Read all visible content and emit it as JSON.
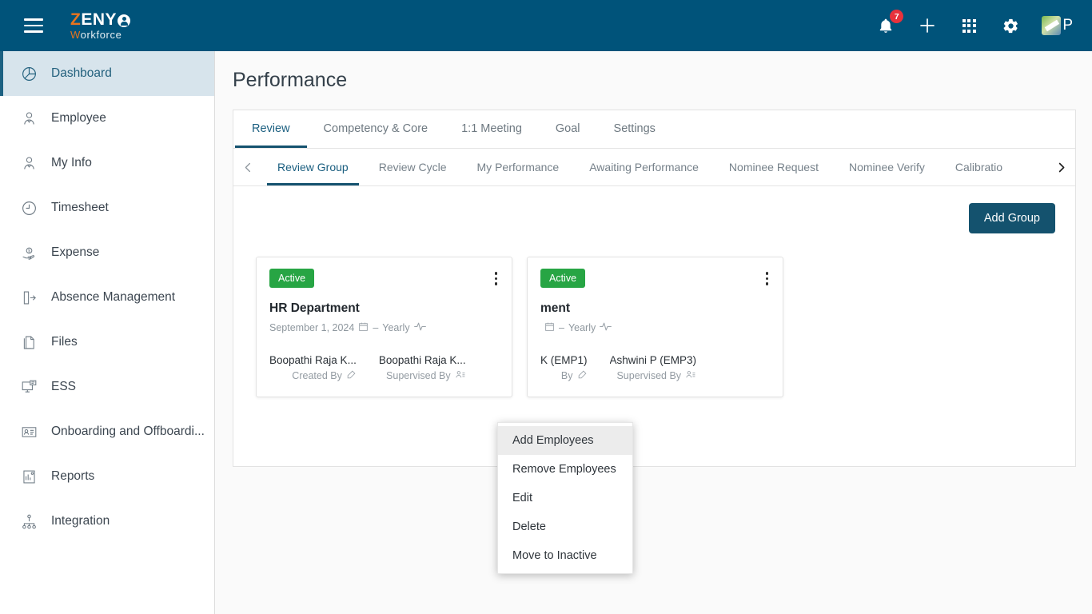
{
  "header": {
    "menu_icon": "hamburger-icon",
    "brand": {
      "z": "Z",
      "eny": "ENY",
      "sub_first": "W",
      "sub_rest": "orkforce"
    },
    "notification_count": "7",
    "icons": [
      "bell-icon",
      "plus-icon",
      "apps-grid-icon",
      "gear-icon",
      "avatar"
    ],
    "avatar_letter": "P"
  },
  "sidebar": {
    "items": [
      {
        "label": "Dashboard",
        "icon": "pie-chart-icon",
        "active": true
      },
      {
        "label": "Employee",
        "icon": "employee-icon",
        "active": false
      },
      {
        "label": "My Info",
        "icon": "my-info-icon",
        "active": false
      },
      {
        "label": "Timesheet",
        "icon": "clock-icon",
        "active": false
      },
      {
        "label": "Expense",
        "icon": "expense-hand-icon",
        "active": false
      },
      {
        "label": "Absence Management",
        "icon": "door-exit-icon",
        "active": false
      },
      {
        "label": "Files",
        "icon": "files-icon",
        "active": false
      },
      {
        "label": "ESS",
        "icon": "ess-monitor-icon",
        "active": false
      },
      {
        "label": "Onboarding and Offboardi...",
        "icon": "id-card-icon",
        "active": false
      },
      {
        "label": "Reports",
        "icon": "reports-icon",
        "active": false
      },
      {
        "label": "Integration",
        "icon": "integration-icon",
        "active": false
      }
    ]
  },
  "main": {
    "page_title": "Performance",
    "primary_tabs": [
      {
        "label": "Review",
        "active": true
      },
      {
        "label": "Competency & Core",
        "active": false
      },
      {
        "label": "1:1 Meeting",
        "active": false
      },
      {
        "label": "Goal",
        "active": false
      },
      {
        "label": "Settings",
        "active": false
      }
    ],
    "secondary_tabs": [
      {
        "label": "Review Group",
        "active": true
      },
      {
        "label": "Review Cycle",
        "active": false
      },
      {
        "label": "My Performance",
        "active": false
      },
      {
        "label": "Awaiting Performance",
        "active": false
      },
      {
        "label": "Nominee Request",
        "active": false
      },
      {
        "label": "Nominee Verify",
        "active": false
      },
      {
        "label": "Calibratio",
        "active": false
      }
    ],
    "scroll_left_icon": "chevron-left-icon",
    "scroll_right_icon": "chevron-right-icon",
    "add_group_label": "Add Group",
    "cards": [
      {
        "status": "Active",
        "title": "HR Department",
        "date": "September 1, 2024",
        "separator": "–",
        "frequency": "Yearly",
        "people": [
          {
            "name": "Boopathi Raja K...",
            "role": "Created By",
            "icon": "edit-icon"
          },
          {
            "name": "Boopathi Raja K...",
            "role": "Supervised By",
            "icon": "supervisor-icon"
          }
        ]
      },
      {
        "status": "Active",
        "title": "ment",
        "date": "",
        "separator": "–",
        "frequency": "Yearly",
        "people": [
          {
            "name": "K (EMP1)",
            "role": "By",
            "icon": "edit-icon"
          },
          {
            "name": "Ashwini P (EMP3)",
            "role": "Supervised By",
            "icon": "supervisor-icon"
          }
        ]
      }
    ],
    "context_menu": [
      {
        "label": "Add Employees",
        "highlight": true
      },
      {
        "label": "Remove Employees",
        "highlight": false
      },
      {
        "label": "Edit",
        "highlight": false
      },
      {
        "label": "Delete",
        "highlight": false
      },
      {
        "label": "Move to Inactive",
        "highlight": false
      }
    ]
  },
  "colors": {
    "header_bg": "#00537a",
    "accent": "#e8741e",
    "active_nav_bg": "#d7e4ec",
    "badge_green": "#27a544",
    "badge_red": "#e8323c",
    "button_blue": "#14526e"
  }
}
